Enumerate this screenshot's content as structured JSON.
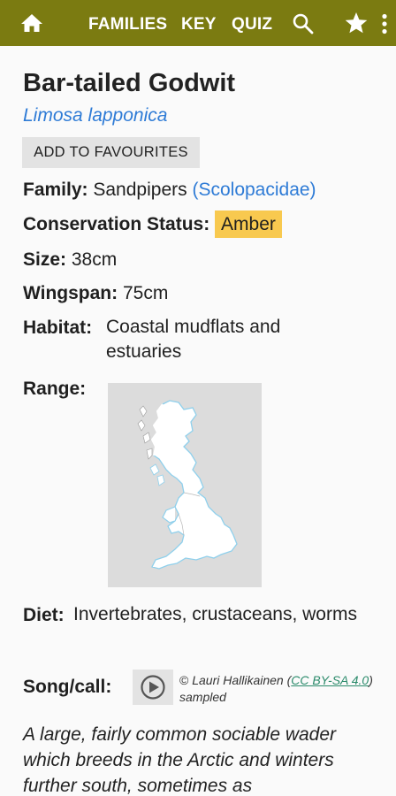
{
  "nav": {
    "families": "FAMILIES",
    "key": "KEY",
    "quiz": "QUIZ",
    "icons": [
      "home-icon",
      "search-icon",
      "star-icon",
      "more-vert-icon"
    ],
    "bar_color": "#7b7b11"
  },
  "species": {
    "common_name": "Bar-tailed Godwit",
    "scientific_name": "Limosa lapponica",
    "favourite_button": "ADD TO FAVOURITES",
    "family_label": "Family:",
    "family_value": "Sandpipers",
    "family_link": "(Scolopacidae)",
    "conservation_label": "Conservation Status:",
    "conservation_value": "Amber",
    "conservation_color": "#f8c94f",
    "size_label": "Size:",
    "size_value": "38cm",
    "wingspan_label": "Wingspan:",
    "wingspan_value": "75cm",
    "habitat_label": "Habitat:",
    "habitat_value": "Coastal mudflats and estuaries",
    "range_label": "Range:",
    "diet_label": "Diet:",
    "diet_value": "Invertebrates, crustaceans, worms",
    "song_label": "Song/call:",
    "credit_symbol": "©",
    "credit_author": "Lauri Hallikainen",
    "credit_license_open": "(",
    "credit_license": "CC BY-SA 4.0",
    "credit_license_close": ")",
    "credit_suffix": "sampled",
    "description": "A large, fairly common sociable wader which breeds in the Arctic and winters further south, sometimes as"
  }
}
